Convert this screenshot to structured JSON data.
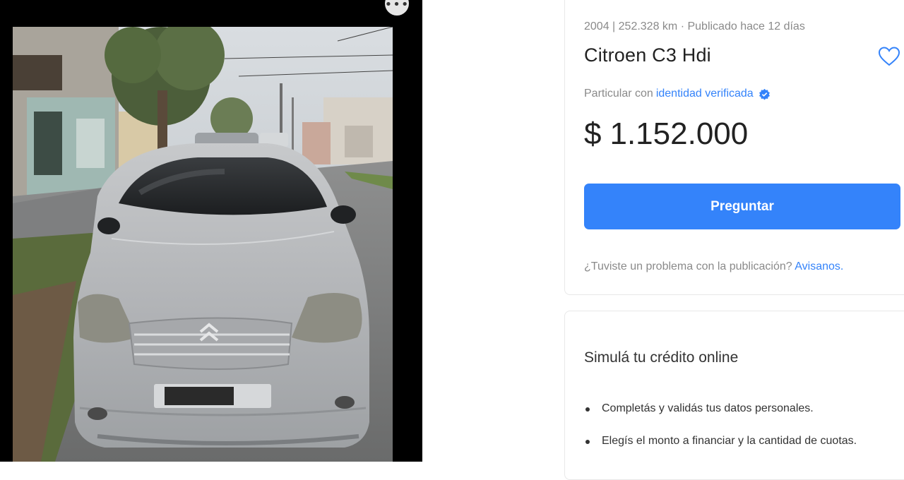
{
  "listing": {
    "meta": "2004 | 252.328 km · Publicado hace 12 días",
    "title": "Citroen C3 Hdi",
    "seller_prefix": "Particular con",
    "seller_link": "identidad verificada",
    "price_currency": "$",
    "price_value": "1.152.000",
    "ask_button": "Preguntar",
    "report_text": "¿Tuviste un problema con la publicación?",
    "report_link": "Avisanos."
  },
  "credit": {
    "title": "Simulá tu crédito online",
    "steps": [
      "Completás y validás tus datos personales.",
      "Elegís el monto a financiar y la cantidad de cuotas."
    ]
  },
  "icons": {
    "more": "more-options-icon",
    "favorite": "heart-icon",
    "verified": "verified-badge-icon"
  },
  "colors": {
    "accent": "#3483fa",
    "text_primary": "#222222",
    "text_secondary": "#8a8a8a",
    "gallery_bg": "#000000"
  }
}
